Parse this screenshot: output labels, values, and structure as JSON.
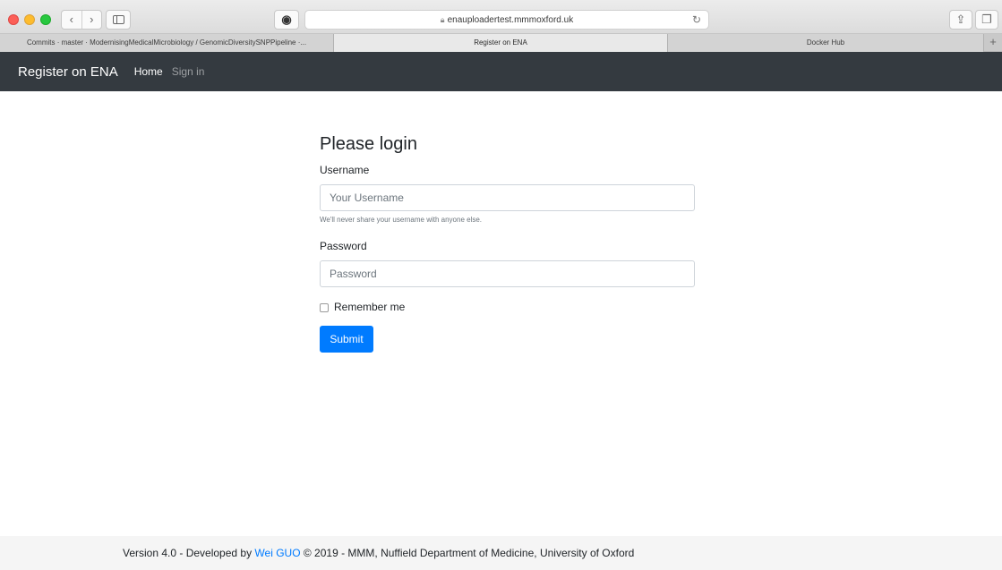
{
  "browser": {
    "url": "enauploadertest.mmmoxford.uk",
    "icons": {
      "back": "chevron-left-icon",
      "forward": "chevron-right-icon",
      "sidebar": "sidebar-icon",
      "reload": "reload-icon",
      "share": "share-icon",
      "tabs": "tabs-icon"
    },
    "tabs": [
      {
        "label": "Commits · master · ModernisingMedicalMicrobiology / GenomicDiversitySNPPipeline ·...",
        "active": false
      },
      {
        "label": "Register on ENA",
        "active": true
      },
      {
        "label": "Docker Hub",
        "active": false
      }
    ],
    "new_tab": "+"
  },
  "navbar": {
    "brand": "Register on ENA",
    "links": [
      {
        "label": "Home",
        "active": true
      },
      {
        "label": "Sign in",
        "active": false
      }
    ],
    "background": "#343a40"
  },
  "form": {
    "title": "Please login",
    "username": {
      "label": "Username",
      "placeholder": "Your Username",
      "value": "",
      "help": "We'll never share your username with anyone else."
    },
    "password": {
      "label": "Password",
      "placeholder": "Password",
      "value": ""
    },
    "remember": {
      "label": "Remember me",
      "checked": false
    },
    "submit_label": "Submit",
    "accent": "#007bff"
  },
  "footer": {
    "prefix": "Version 4.0 - Developed by ",
    "author": "Wei GUO",
    "suffix": " © 2019 - MMM, Nuffield Department of Medicine, University of Oxford"
  }
}
